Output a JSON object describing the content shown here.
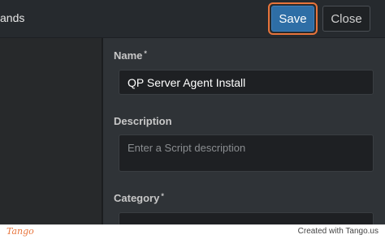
{
  "header": {
    "title_fragment": "ands",
    "save_label": "Save",
    "close_label": "Close"
  },
  "form": {
    "name": {
      "label": "Name",
      "required_marker": "*",
      "value": "QP Server Agent Install"
    },
    "description": {
      "label": "Description",
      "placeholder": "Enter a Script description",
      "value": ""
    },
    "category": {
      "label": "Category",
      "required_marker": "*"
    }
  },
  "footer": {
    "logo": "Tango",
    "credit": "Created with Tango.us"
  },
  "colors": {
    "accent_highlight": "#e8743b",
    "primary_button": "#2e6ea6",
    "background": "#2f3337"
  }
}
